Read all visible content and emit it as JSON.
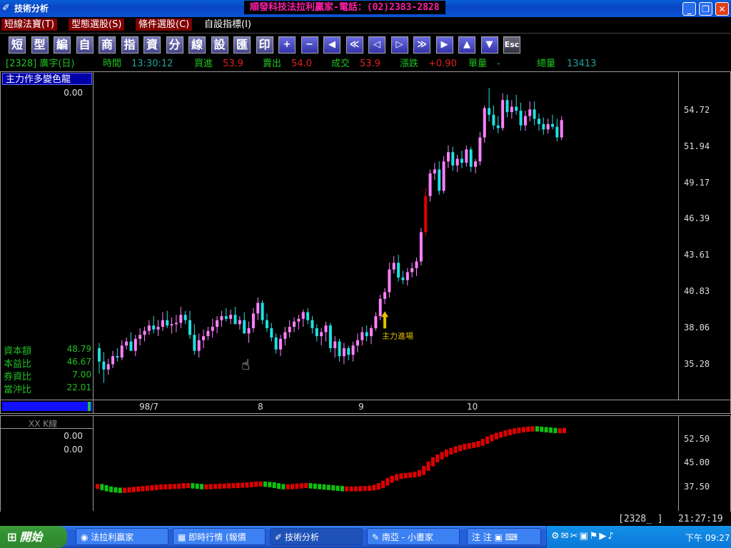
{
  "window": {
    "title": "技術分析",
    "banner": "順發科技法拉利贏家-電話：(02)2383-2828",
    "buttons": {
      "min": "_",
      "max": "❐",
      "close": "✕"
    }
  },
  "menu": [
    {
      "label": "短線法寶(T)"
    },
    {
      "label": "型態選股(S)"
    },
    {
      "label": "條件選股(C)"
    },
    {
      "label": "自設指標(I)"
    }
  ],
  "toolbar": [
    "短",
    "型",
    "編",
    "自",
    "商",
    "指",
    "資",
    "分",
    "線",
    "設",
    "匯",
    "印",
    "+",
    "−",
    "◀",
    "≪",
    "◁",
    "▷",
    "≫",
    "▶",
    "▲",
    "▼",
    "Esc"
  ],
  "quote": {
    "symbol": "[2328] 廣宇(日)",
    "time_label": "時間",
    "time": "13:30:12",
    "bid_label": "買進",
    "bid": "53.9",
    "ask_label": "賣出",
    "ask": "54.0",
    "deal_label": "成交",
    "deal": "53.9",
    "change_label": "漲跌",
    "change": "+0.90",
    "vol_label": "單量",
    "vol": "-",
    "total_label": "總量",
    "total": "13413"
  },
  "main_panel": {
    "indicator_name": "主力作多變色龍",
    "indicator_value": "0.00",
    "stats": [
      {
        "label": "資本額",
        "value": "48.79"
      },
      {
        "label": "本益比",
        "value": "46.67"
      },
      {
        "label": "券資比",
        "value": "7.00"
      },
      {
        "label": "當沖比",
        "value": "22.01"
      }
    ],
    "annotation": "主力進場",
    "annotation_color": "#e0c000"
  },
  "indicator_panel": {
    "title": "XX K線",
    "values": [
      "0.00",
      "0.00"
    ],
    "scale": [
      "52.50",
      "45.00",
      "37.50"
    ]
  },
  "status": {
    "symbol": "[2328_ ]",
    "clock": "21:27:19"
  },
  "taskbar": {
    "start": "開始",
    "tasks": [
      "法拉利贏家",
      "即時行情 (報價",
      "技術分析",
      "南亞 - 小畫家"
    ],
    "ime": "注 注 ▣ ⌨",
    "tray_clock": "下午 09:27"
  },
  "chart_data": {
    "type": "candlestick",
    "x_ticks": [
      "98/7",
      "8",
      "9",
      "10"
    ],
    "y_ticks": [
      "54.72",
      "51.94",
      "49.17",
      "46.39",
      "43.61",
      "40.83",
      "38.06",
      "35.28"
    ],
    "ylim": [
      33.0,
      57.5
    ],
    "colors": {
      "down": "#20e0e0",
      "up_thin": "#ff80ff",
      "up_strong": "#e00000"
    },
    "candles": [
      [
        36.8,
        37.2,
        34.9,
        35.8
      ],
      [
        35.8,
        36.5,
        34.2,
        35.2
      ],
      [
        35.2,
        36.0,
        34.8,
        35.6
      ],
      [
        35.6,
        36.6,
        35.3,
        36.2
      ],
      [
        36.2,
        36.8,
        35.8,
        36.1
      ],
      [
        36.1,
        37.4,
        35.9,
        37.0
      ],
      [
        37.0,
        37.6,
        36.7,
        37.3
      ],
      [
        37.3,
        38.0,
        36.9,
        36.6
      ],
      [
        36.6,
        37.8,
        36.2,
        37.5
      ],
      [
        37.5,
        38.3,
        37.0,
        37.8
      ],
      [
        37.8,
        38.4,
        37.3,
        38.1
      ],
      [
        38.1,
        38.9,
        37.8,
        38.5
      ],
      [
        38.5,
        39.2,
        37.9,
        38.2
      ],
      [
        38.2,
        38.9,
        37.7,
        38.4
      ],
      [
        38.4,
        39.5,
        38.1,
        38.9
      ],
      [
        38.9,
        39.6,
        38.3,
        38.5
      ],
      [
        38.5,
        39.1,
        37.9,
        38.6
      ],
      [
        38.6,
        39.3,
        38.0,
        38.7
      ],
      [
        38.7,
        39.9,
        38.3,
        39.3
      ],
      [
        39.3,
        39.6,
        38.6,
        38.9
      ],
      [
        38.9,
        39.6,
        37.5,
        37.8
      ],
      [
        37.8,
        38.6,
        36.3,
        36.6
      ],
      [
        36.6,
        37.9,
        36.1,
        37.4
      ],
      [
        37.4,
        38.2,
        36.8,
        37.7
      ],
      [
        37.7,
        38.4,
        37.4,
        38.1
      ],
      [
        38.1,
        39.0,
        37.6,
        38.4
      ],
      [
        38.4,
        39.2,
        37.9,
        38.9
      ],
      [
        38.9,
        39.6,
        38.4,
        39.2
      ],
      [
        39.2,
        39.8,
        38.8,
        39.0
      ],
      [
        39.0,
        39.7,
        38.6,
        39.3
      ],
      [
        39.3,
        39.9,
        38.9,
        38.6
      ],
      [
        38.6,
        39.2,
        38.2,
        38.9
      ],
      [
        38.9,
        39.5,
        38.4,
        37.9
      ],
      [
        37.9,
        38.8,
        37.2,
        38.3
      ],
      [
        38.3,
        39.8,
        38.0,
        39.4
      ],
      [
        39.4,
        40.6,
        38.9,
        40.2
      ],
      [
        40.2,
        40.4,
        38.6,
        38.9
      ],
      [
        38.9,
        39.4,
        38.0,
        38.3
      ],
      [
        38.3,
        38.7,
        37.3,
        37.6
      ],
      [
        37.6,
        37.9,
        36.4,
        36.7
      ],
      [
        36.7,
        37.8,
        36.2,
        37.5
      ],
      [
        37.5,
        38.4,
        37.0,
        38.0
      ],
      [
        38.0,
        38.9,
        37.6,
        38.4
      ],
      [
        38.4,
        39.1,
        38.0,
        38.8
      ],
      [
        38.8,
        39.3,
        38.2,
        39.0
      ],
      [
        39.0,
        39.7,
        38.4,
        39.5
      ],
      [
        39.5,
        39.8,
        38.6,
        38.9
      ],
      [
        38.9,
        39.2,
        37.9,
        38.3
      ],
      [
        38.3,
        38.6,
        37.3,
        37.7
      ],
      [
        37.7,
        38.3,
        37.0,
        38.0
      ],
      [
        38.0,
        38.8,
        37.3,
        38.5
      ],
      [
        38.5,
        38.7,
        36.5,
        36.8
      ],
      [
        36.8,
        37.7,
        36.1,
        37.3
      ],
      [
        37.3,
        37.5,
        35.8,
        36.2
      ],
      [
        36.2,
        37.2,
        35.6,
        36.8
      ],
      [
        36.8,
        37.0,
        35.9,
        36.3
      ],
      [
        36.3,
        37.3,
        35.8,
        37.0
      ],
      [
        37.0,
        37.9,
        36.5,
        37.4
      ],
      [
        37.4,
        38.4,
        37.0,
        38.0
      ],
      [
        38.0,
        38.5,
        37.3,
        37.7
      ],
      [
        37.7,
        38.5,
        37.1,
        38.3
      ],
      [
        38.3,
        39.5,
        38.1,
        39.2
      ],
      [
        39.2,
        40.8,
        38.9,
        40.5
      ],
      [
        40.5,
        41.3,
        40.1,
        41.0
      ],
      [
        41.0,
        43.2,
        40.6,
        42.7
      ],
      [
        42.7,
        43.7,
        42.4,
        43.2
      ],
      [
        43.2,
        43.8,
        41.8,
        42.1
      ],
      [
        42.1,
        42.6,
        41.6,
        41.9
      ],
      [
        41.9,
        42.8,
        41.5,
        42.5
      ],
      [
        42.5,
        43.2,
        42.1,
        42.8
      ],
      [
        42.8,
        43.6,
        42.2,
        43.3
      ],
      [
        43.3,
        45.8,
        43.0,
        45.5
      ],
      [
        45.5,
        48.8,
        45.2,
        48.2
      ],
      [
        48.2,
        50.2,
        47.8,
        49.9
      ],
      [
        49.9,
        50.7,
        49.4,
        50.2
      ],
      [
        50.2,
        50.8,
        48.3,
        48.6
      ],
      [
        48.6,
        51.2,
        48.4,
        50.8
      ],
      [
        50.8,
        52.0,
        50.3,
        51.5
      ],
      [
        51.5,
        51.9,
        50.1,
        50.5
      ],
      [
        50.5,
        51.3,
        50.0,
        51.0
      ],
      [
        51.0,
        51.6,
        50.3,
        50.7
      ],
      [
        50.7,
        52.0,
        50.4,
        51.7
      ],
      [
        51.7,
        51.9,
        50.0,
        50.4
      ],
      [
        50.4,
        51.0,
        49.9,
        50.8
      ],
      [
        50.8,
        53.0,
        50.5,
        52.6
      ],
      [
        52.6,
        55.0,
        52.2,
        54.8
      ],
      [
        54.8,
        56.3,
        53.8,
        54.3
      ],
      [
        54.3,
        55.0,
        53.2,
        53.5
      ],
      [
        53.5,
        54.2,
        52.9,
        53.3
      ],
      [
        53.3,
        55.9,
        53.1,
        55.4
      ],
      [
        55.4,
        55.8,
        54.1,
        54.5
      ],
      [
        54.5,
        55.4,
        54.0,
        54.9
      ],
      [
        54.9,
        55.8,
        54.3,
        54.6
      ],
      [
        54.6,
        55.2,
        53.1,
        53.5
      ],
      [
        53.5,
        54.6,
        53.1,
        54.2
      ],
      [
        54.2,
        55.3,
        53.8,
        54.7
      ],
      [
        54.7,
        55.3,
        53.5,
        54.0
      ],
      [
        54.0,
        54.4,
        53.1,
        53.6
      ],
      [
        53.6,
        54.1,
        52.8,
        53.2
      ],
      [
        53.2,
        54.0,
        52.9,
        53.6
      ],
      [
        53.6,
        54.3,
        53.2,
        53.4
      ],
      [
        53.4,
        54.0,
        52.3,
        52.6
      ],
      [
        52.6,
        54.2,
        52.4,
        53.9
      ]
    ],
    "signal_index": 63,
    "indicator_series": {
      "name": "XX K線",
      "ylim": [
        33.0,
        56.0
      ],
      "values": [
        38.8,
        38.5,
        38.2,
        38.0,
        37.9,
        37.8,
        37.9,
        38.0,
        38.1,
        38.2,
        38.3,
        38.4,
        38.5,
        38.6,
        38.7,
        38.7,
        38.8,
        38.8,
        38.9,
        39.0,
        39.0,
        38.9,
        38.8,
        38.7,
        38.7,
        38.8,
        38.8,
        38.9,
        38.9,
        39.0,
        39.0,
        39.1,
        39.1,
        39.2,
        39.3,
        39.4,
        39.4,
        39.3,
        39.2,
        39.0,
        38.8,
        38.7,
        38.7,
        38.8,
        38.9,
        39.0,
        39.0,
        38.9,
        38.8,
        38.7,
        38.6,
        38.5,
        38.4,
        38.3,
        38.2,
        38.2,
        38.2,
        38.2,
        38.3,
        38.3,
        38.4,
        38.6,
        39.0,
        39.6,
        40.3,
        40.8,
        41.2,
        41.4,
        41.5,
        41.6,
        41.8,
        42.2,
        43.2,
        44.3,
        45.3,
        46.0,
        46.6,
        47.2,
        47.6,
        48.0,
        48.3,
        48.6,
        48.8,
        49.0,
        49.3,
        49.8,
        50.4,
        50.9,
        51.3,
        51.6,
        51.9,
        52.2,
        52.4,
        52.6,
        52.7,
        52.8,
        52.9,
        52.8,
        52.7,
        52.6,
        52.5,
        52.4,
        52.4,
        52.5
      ]
    }
  }
}
